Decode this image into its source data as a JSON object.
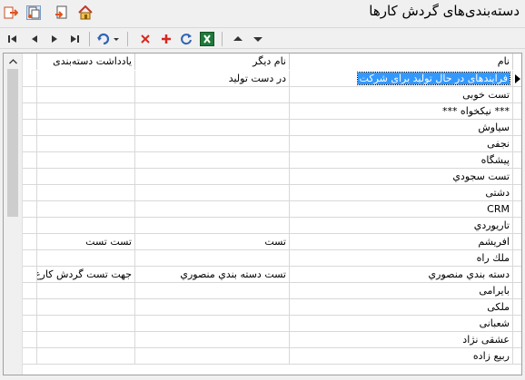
{
  "window": {
    "title": "دسته‌بندی‌های گردش کارها"
  },
  "titlebar_icons": [
    "exit-icon",
    "copy-window-icon",
    "new-window-icon",
    "home-icon"
  ],
  "toolbar": {
    "nav": [
      "first-record-icon",
      "previous-record-icon",
      "next-record-icon",
      "last-record-icon"
    ],
    "actions": [
      "refresh-dropdown-icon",
      "delete-icon",
      "add-icon",
      "reload-icon",
      "excel-icon"
    ],
    "sort": [
      "sort-up-icon",
      "sort-down-icon"
    ]
  },
  "columns": {
    "note": "يادداشت دسته‌بندی",
    "other_name": "نام دیگر",
    "name": "نام"
  },
  "rows": [
    {
      "name": "فرایندهای در حال تولید برای شرکت",
      "other_name": "در دست تولید",
      "note": "",
      "selected": true
    },
    {
      "name": "تست خوبی",
      "other_name": "",
      "note": ""
    },
    {
      "name": "*** نیکخواه ***",
      "other_name": "",
      "note": ""
    },
    {
      "name": "سیاوش",
      "other_name": "",
      "note": ""
    },
    {
      "name": "نجفی",
      "other_name": "",
      "note": ""
    },
    {
      "name": "پیشگاه",
      "other_name": "",
      "note": ""
    },
    {
      "name": "تست سجودي",
      "other_name": "",
      "note": ""
    },
    {
      "name": "دشتی",
      "other_name": "",
      "note": ""
    },
    {
      "name": "CRM",
      "other_name": "",
      "note": ""
    },
    {
      "name": "تاریوردي",
      "other_name": "",
      "note": ""
    },
    {
      "name": "افریشم",
      "other_name": "تست",
      "note": "تست تست"
    },
    {
      "name": "ملك راه",
      "other_name": "",
      "note": ""
    },
    {
      "name": "دسته بندي منصوري",
      "other_name": "تست دسته بندي منصوري",
      "note": "جهت تست گردش کارع"
    },
    {
      "name": "بایرامی",
      "other_name": "",
      "note": ""
    },
    {
      "name": "ملکی",
      "other_name": "",
      "note": ""
    },
    {
      "name": "شعبانی",
      "other_name": "",
      "note": ""
    },
    {
      "name": "عشقی نژاد",
      "other_name": "",
      "note": ""
    },
    {
      "name": "ربیع زاده",
      "other_name": "",
      "note": ""
    }
  ]
}
